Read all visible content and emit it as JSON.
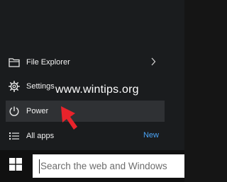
{
  "start_menu": {
    "items": [
      {
        "label": "File Explorer",
        "icon": "folder-icon",
        "has_submenu": true
      },
      {
        "label": "Settings",
        "icon": "gear-icon"
      },
      {
        "label": "Power",
        "icon": "power-icon"
      },
      {
        "label": "All apps",
        "icon": "list-icon",
        "badge": "New"
      }
    ]
  },
  "watermark": "www.wintips.org",
  "taskbar": {
    "start_icon": "windows-logo-icon",
    "search_placeholder": "Search the web and Windows"
  },
  "annotation": {
    "icon": "red-arrow-icon",
    "color": "#e8232b"
  },
  "colors": {
    "accent": "#4aa3f5",
    "menu_background": "#1a1c1e",
    "hover": "#2f3134"
  }
}
